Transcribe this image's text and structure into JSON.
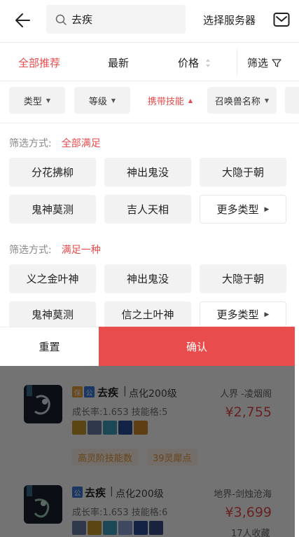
{
  "header": {
    "search_text": "去疾",
    "server_label": "选择服务器"
  },
  "sortbar": {
    "all": "全部推荐",
    "latest": "最新",
    "price": "价格",
    "filter": "筛选"
  },
  "chips": [
    "类型",
    "等级",
    "携带技能",
    "召唤兽名称"
  ],
  "section1": {
    "label": "筛选方式:",
    "value": "全部满足",
    "options": [
      "分花拂柳",
      "神出鬼没",
      "大隐于朝",
      "鬼神莫测",
      "吉人天相",
      "更多类型"
    ]
  },
  "section2": {
    "label": "筛选方式:",
    "value": "满足一种",
    "options": [
      "义之金叶神",
      "神出鬼没",
      "大隐于朝",
      "鬼神莫测",
      "信之土叶神",
      "更多类型"
    ]
  },
  "actions": {
    "reset": "重置",
    "confirm": "确认"
  },
  "listings": [
    {
      "badge1": "保",
      "badge2": "公",
      "name": "去疾",
      "sep": "|",
      "level": "点化200级",
      "server": "人界 -凌烟阁",
      "growth": "成长率:1.653 技能格:5",
      "price": "¥2,755",
      "tags": [
        "高灵阶技能数",
        "39灵犀点"
      ]
    },
    {
      "badge2": "公",
      "name": "去疾",
      "sep": "|",
      "level": "点化200级",
      "server": "地界-剑烛沧海",
      "growth": "成长率:1.653 技能格:6",
      "price": "¥3,699",
      "fav": "17人收藏"
    }
  ]
}
